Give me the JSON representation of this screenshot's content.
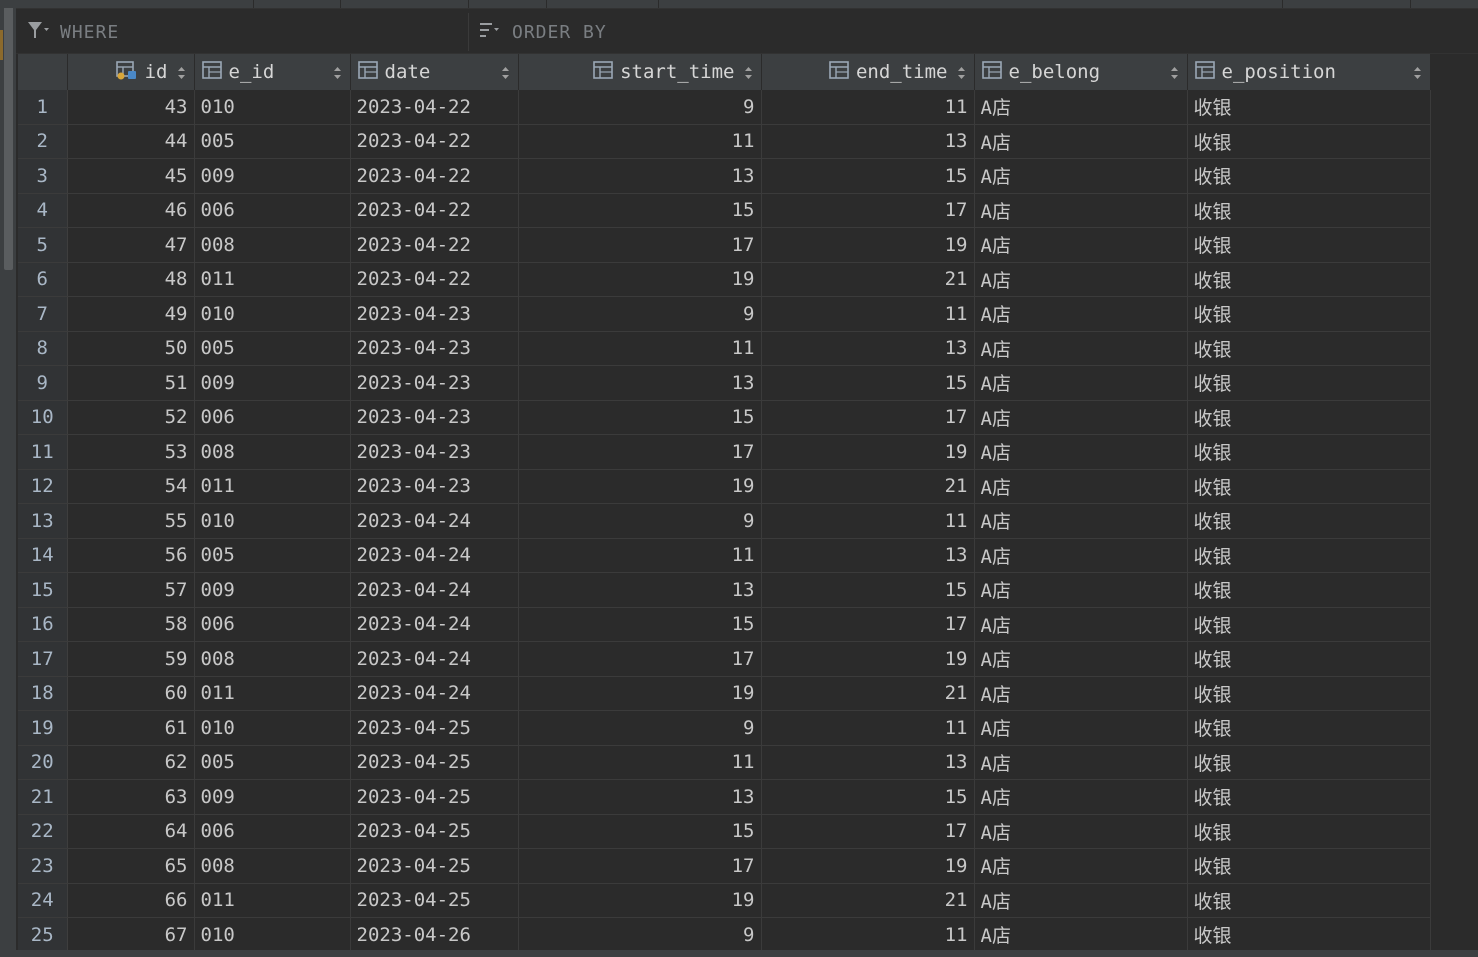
{
  "filter": {
    "where_label": "WHERE",
    "orderby_label": "ORDER BY"
  },
  "columns": [
    "id",
    "e_id",
    "date",
    "start_time",
    "end_time",
    "e_belong",
    "e_position"
  ],
  "rows": [
    {
      "n": "1",
      "id": "43",
      "e_id": "010",
      "date": "2023-04-22",
      "start_time": "9",
      "end_time": "11",
      "e_belong": "A店",
      "e_position": "收银"
    },
    {
      "n": "2",
      "id": "44",
      "e_id": "005",
      "date": "2023-04-22",
      "start_time": "11",
      "end_time": "13",
      "e_belong": "A店",
      "e_position": "收银"
    },
    {
      "n": "3",
      "id": "45",
      "e_id": "009",
      "date": "2023-04-22",
      "start_time": "13",
      "end_time": "15",
      "e_belong": "A店",
      "e_position": "收银"
    },
    {
      "n": "4",
      "id": "46",
      "e_id": "006",
      "date": "2023-04-22",
      "start_time": "15",
      "end_time": "17",
      "e_belong": "A店",
      "e_position": "收银"
    },
    {
      "n": "5",
      "id": "47",
      "e_id": "008",
      "date": "2023-04-22",
      "start_time": "17",
      "end_time": "19",
      "e_belong": "A店",
      "e_position": "收银"
    },
    {
      "n": "6",
      "id": "48",
      "e_id": "011",
      "date": "2023-04-22",
      "start_time": "19",
      "end_time": "21",
      "e_belong": "A店",
      "e_position": "收银"
    },
    {
      "n": "7",
      "id": "49",
      "e_id": "010",
      "date": "2023-04-23",
      "start_time": "9",
      "end_time": "11",
      "e_belong": "A店",
      "e_position": "收银"
    },
    {
      "n": "8",
      "id": "50",
      "e_id": "005",
      "date": "2023-04-23",
      "start_time": "11",
      "end_time": "13",
      "e_belong": "A店",
      "e_position": "收银"
    },
    {
      "n": "9",
      "id": "51",
      "e_id": "009",
      "date": "2023-04-23",
      "start_time": "13",
      "end_time": "15",
      "e_belong": "A店",
      "e_position": "收银"
    },
    {
      "n": "10",
      "id": "52",
      "e_id": "006",
      "date": "2023-04-23",
      "start_time": "15",
      "end_time": "17",
      "e_belong": "A店",
      "e_position": "收银"
    },
    {
      "n": "11",
      "id": "53",
      "e_id": "008",
      "date": "2023-04-23",
      "start_time": "17",
      "end_time": "19",
      "e_belong": "A店",
      "e_position": "收银"
    },
    {
      "n": "12",
      "id": "54",
      "e_id": "011",
      "date": "2023-04-23",
      "start_time": "19",
      "end_time": "21",
      "e_belong": "A店",
      "e_position": "收银"
    },
    {
      "n": "13",
      "id": "55",
      "e_id": "010",
      "date": "2023-04-24",
      "start_time": "9",
      "end_time": "11",
      "e_belong": "A店",
      "e_position": "收银"
    },
    {
      "n": "14",
      "id": "56",
      "e_id": "005",
      "date": "2023-04-24",
      "start_time": "11",
      "end_time": "13",
      "e_belong": "A店",
      "e_position": "收银"
    },
    {
      "n": "15",
      "id": "57",
      "e_id": "009",
      "date": "2023-04-24",
      "start_time": "13",
      "end_time": "15",
      "e_belong": "A店",
      "e_position": "收银"
    },
    {
      "n": "16",
      "id": "58",
      "e_id": "006",
      "date": "2023-04-24",
      "start_time": "15",
      "end_time": "17",
      "e_belong": "A店",
      "e_position": "收银"
    },
    {
      "n": "17",
      "id": "59",
      "e_id": "008",
      "date": "2023-04-24",
      "start_time": "17",
      "end_time": "19",
      "e_belong": "A店",
      "e_position": "收银"
    },
    {
      "n": "18",
      "id": "60",
      "e_id": "011",
      "date": "2023-04-24",
      "start_time": "19",
      "end_time": "21",
      "e_belong": "A店",
      "e_position": "收银"
    },
    {
      "n": "19",
      "id": "61",
      "e_id": "010",
      "date": "2023-04-25",
      "start_time": "9",
      "end_time": "11",
      "e_belong": "A店",
      "e_position": "收银"
    },
    {
      "n": "20",
      "id": "62",
      "e_id": "005",
      "date": "2023-04-25",
      "start_time": "11",
      "end_time": "13",
      "e_belong": "A店",
      "e_position": "收银"
    },
    {
      "n": "21",
      "id": "63",
      "e_id": "009",
      "date": "2023-04-25",
      "start_time": "13",
      "end_time": "15",
      "e_belong": "A店",
      "e_position": "收银"
    },
    {
      "n": "22",
      "id": "64",
      "e_id": "006",
      "date": "2023-04-25",
      "start_time": "15",
      "end_time": "17",
      "e_belong": "A店",
      "e_position": "收银"
    },
    {
      "n": "23",
      "id": "65",
      "e_id": "008",
      "date": "2023-04-25",
      "start_time": "17",
      "end_time": "19",
      "e_belong": "A店",
      "e_position": "收银"
    },
    {
      "n": "24",
      "id": "66",
      "e_id": "011",
      "date": "2023-04-25",
      "start_time": "19",
      "end_time": "21",
      "e_belong": "A店",
      "e_position": "收银"
    },
    {
      "n": "25",
      "id": "67",
      "e_id": "010",
      "date": "2023-04-26",
      "start_time": "9",
      "end_time": "11",
      "e_belong": "A店",
      "e_position": "收银"
    }
  ]
}
